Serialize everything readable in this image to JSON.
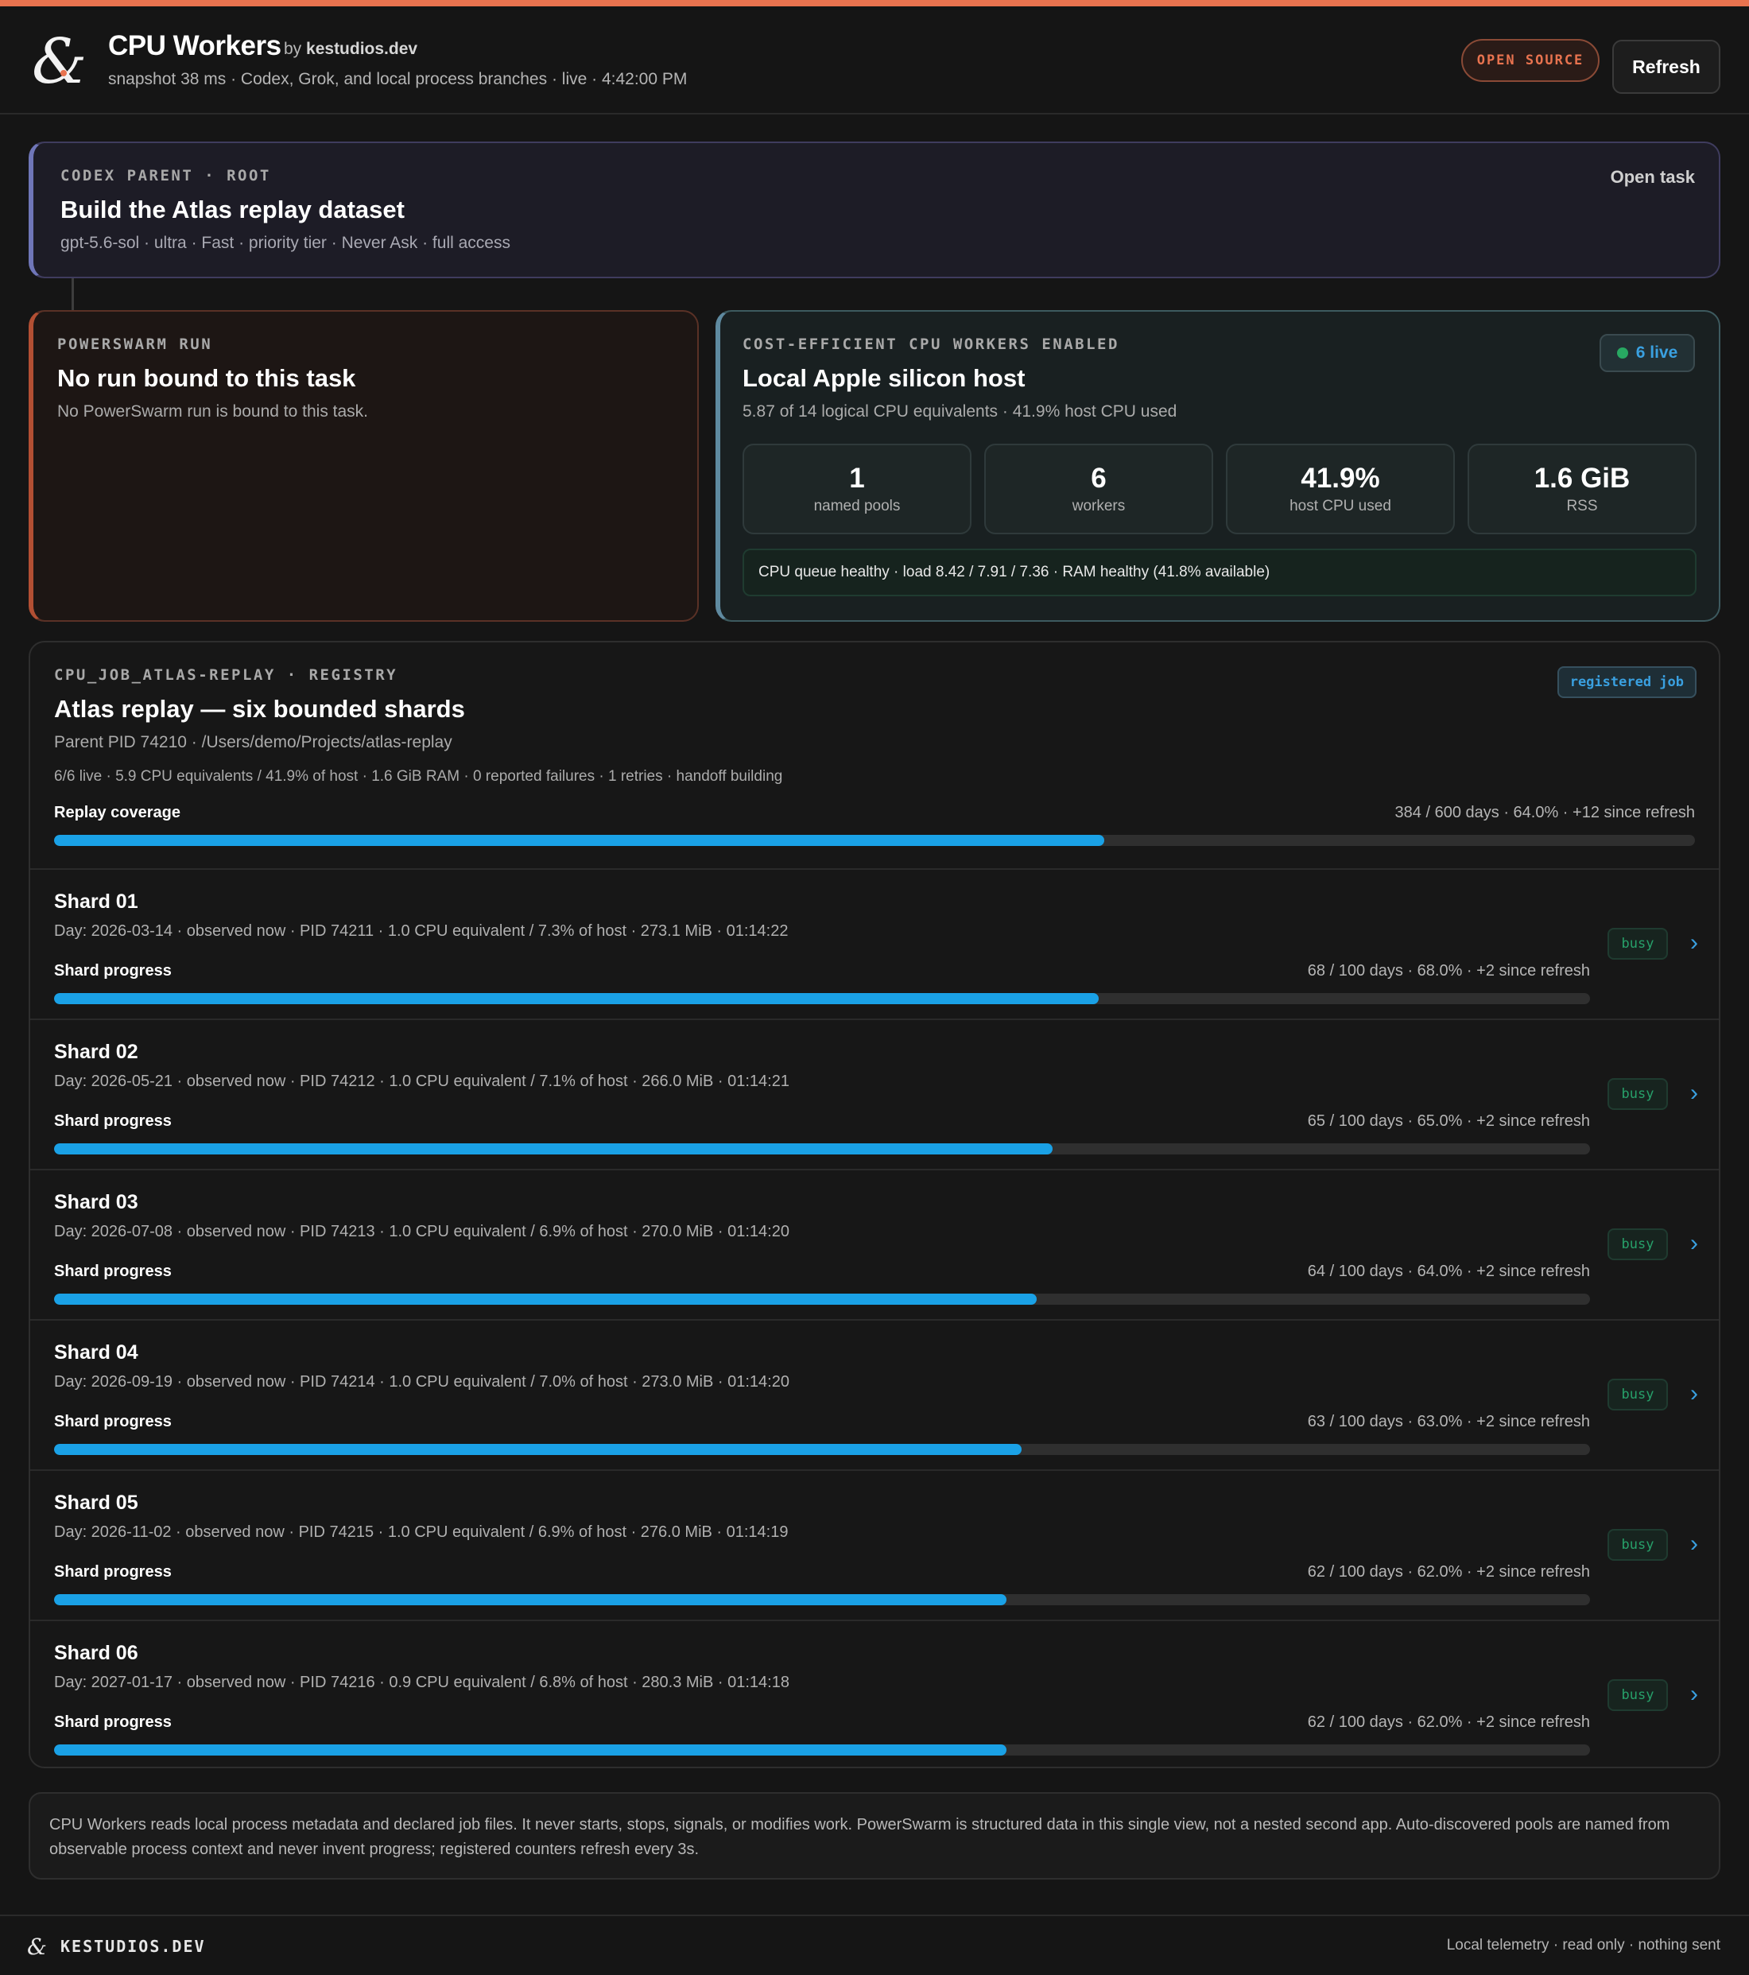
{
  "header": {
    "title": "CPU Workers",
    "by_prefix": "by",
    "by_name": "kestudios.dev",
    "subtitle": "snapshot 38 ms · Codex, Grok, and local process branches · live · 4:42:00 PM",
    "open_source_badge": "OPEN SOURCE",
    "refresh_label": "Refresh",
    "accent_color": "#e8734f"
  },
  "parent": {
    "eyebrow": "CODEX PARENT · ROOT",
    "title": "Build the Atlas replay dataset",
    "meta": "gpt-5.6-sol · ultra · Fast · priority tier · Never Ask · full access",
    "open_task_label": "Open task"
  },
  "powerswarm": {
    "eyebrow": "POWERSWARM RUN",
    "title": "No run bound to this task",
    "meta": "No PowerSwarm run is bound to this task."
  },
  "host": {
    "eyebrow": "COST-EFFICIENT CPU WORKERS ENABLED",
    "title": "Local Apple silicon host",
    "meta": "5.87 of 14 logical CPU equivalents · 41.9% host CPU used",
    "live_label": "6 live",
    "stats": [
      {
        "value": "1",
        "label": "named pools"
      },
      {
        "value": "6",
        "label": "workers"
      },
      {
        "value": "41.9%",
        "label": "host CPU used"
      },
      {
        "value": "1.6 GiB",
        "label": "RSS"
      }
    ],
    "health": "CPU queue healthy · load 8.42 / 7.91 / 7.36 · RAM healthy (41.8% available)"
  },
  "registry": {
    "eyebrow": "CPU_JOB_ATLAS-REPLAY · REGISTRY",
    "badge": "registered job",
    "title": "Atlas replay — six bounded shards",
    "meta": "Parent PID 74210 · /Users/demo/Projects/atlas-replay",
    "meta2": "6/6 live · 5.9 CPU equivalents / 41.9% of host · 1.6 GiB RAM · 0 reported failures · 1 retries · handoff building",
    "progress_label": "Replay coverage",
    "progress_text": "384 / 600 days · 64.0% · +12 since refresh",
    "progress_fraction": 0.64
  },
  "shards": [
    {
      "name": "Shard 01",
      "meta": "Day: 2026-03-14 · observed now · PID 74211 · 1.0 CPU equivalent / 7.3% of host · 273.1 MiB · 01:14:22",
      "progress_label": "Shard progress",
      "progress_text": "68 / 100 days · 68.0% · +2 since refresh",
      "progress_fraction": 0.68,
      "status": "busy"
    },
    {
      "name": "Shard 02",
      "meta": "Day: 2026-05-21 · observed now · PID 74212 · 1.0 CPU equivalent / 7.1% of host · 266.0 MiB · 01:14:21",
      "progress_label": "Shard progress",
      "progress_text": "65 / 100 days · 65.0% · +2 since refresh",
      "progress_fraction": 0.65,
      "status": "busy"
    },
    {
      "name": "Shard 03",
      "meta": "Day: 2026-07-08 · observed now · PID 74213 · 1.0 CPU equivalent / 6.9% of host · 270.0 MiB · 01:14:20",
      "progress_label": "Shard progress",
      "progress_text": "64 / 100 days · 64.0% · +2 since refresh",
      "progress_fraction": 0.64,
      "status": "busy"
    },
    {
      "name": "Shard 04",
      "meta": "Day: 2026-09-19 · observed now · PID 74214 · 1.0 CPU equivalent / 7.0% of host · 273.0 MiB · 01:14:20",
      "progress_label": "Shard progress",
      "progress_text": "63 / 100 days · 63.0% · +2 since refresh",
      "progress_fraction": 0.63,
      "status": "busy"
    },
    {
      "name": "Shard 05",
      "meta": "Day: 2026-11-02 · observed now · PID 74215 · 1.0 CPU equivalent / 6.9% of host · 276.0 MiB · 01:14:19",
      "progress_label": "Shard progress",
      "progress_text": "62 / 100 days · 62.0% · +2 since refresh",
      "progress_fraction": 0.62,
      "status": "busy"
    },
    {
      "name": "Shard 06",
      "meta": "Day: 2027-01-17 · observed now · PID 74216 · 0.9 CPU equivalent / 6.8% of host · 280.3 MiB · 01:14:18",
      "progress_label": "Shard progress",
      "progress_text": "62 / 100 days · 62.0% · +2 since refresh",
      "progress_fraction": 0.62,
      "status": "busy"
    }
  ],
  "footnote": "CPU Workers reads local process metadata and declared job files. It never starts, stops, signals, or modifies work. PowerSwarm is structured data in this single view, not a nested second app. Auto-discovered pools are named from observable process context and never invent progress; registered counters refresh every 3s.",
  "footer": {
    "brand": "KESTUDIOS.DEV",
    "right": "Local telemetry · read only · nothing sent"
  }
}
